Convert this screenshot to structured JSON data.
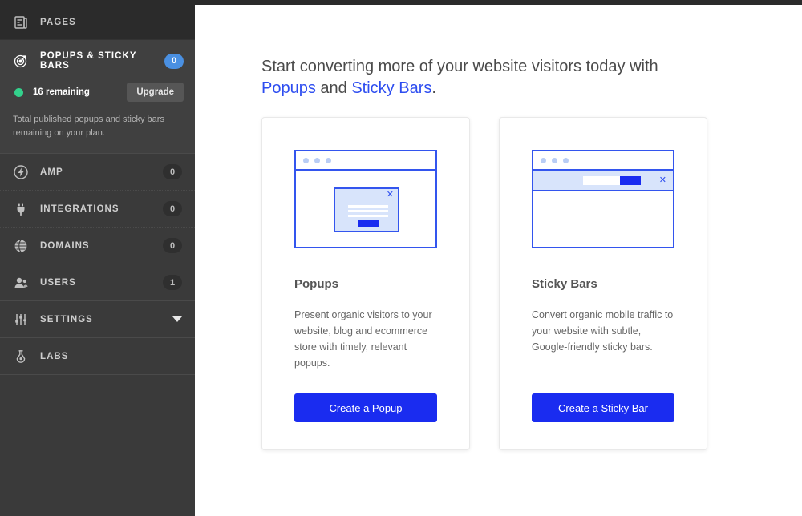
{
  "sidebar": {
    "pages": {
      "label": "PAGES",
      "icon": "pages-icon"
    },
    "active": {
      "label": "POPUPS & STICKY BARS",
      "icon": "target-icon",
      "badge": "0",
      "remaining_text": "16 remaining",
      "upgrade_label": "Upgrade",
      "plan_note": "Total published popups and sticky bars remaining on your plan.",
      "status_color": "#33d18c",
      "badge_color": "#4a90e2"
    },
    "items": [
      {
        "label": "AMP",
        "icon": "bolt-icon",
        "badge": "0"
      },
      {
        "label": "INTEGRATIONS",
        "icon": "plug-icon",
        "badge": "0"
      },
      {
        "label": "DOMAINS",
        "icon": "globe-icon",
        "badge": "0"
      },
      {
        "label": "USERS",
        "icon": "users-icon",
        "badge": "1"
      },
      {
        "label": "SETTINGS",
        "icon": "sliders-icon",
        "badge": ""
      },
      {
        "label": "LABS",
        "icon": "flask-icon",
        "badge": ""
      }
    ]
  },
  "main": {
    "headline": {
      "part1": "Start converting more of your website visitors today with ",
      "link1": "Popups",
      "part2": " and ",
      "link2": "Sticky Bars",
      "part3": ".",
      "link_color": "#2d4df0"
    },
    "cards": [
      {
        "title": "Popups",
        "description": "Present organic visitors to your website, blog and ecommerce store with timely, relevant popups.",
        "cta": "Create a Popup",
        "illustration": "popup-illustration",
        "accent": "#1a2cf0"
      },
      {
        "title": "Sticky Bars",
        "description": "Convert organic mobile traffic to your website with subtle, Google-friendly sticky bars.",
        "cta": "Create a Sticky Bar",
        "illustration": "stickybar-illustration",
        "accent": "#1a2cf0"
      }
    ]
  }
}
